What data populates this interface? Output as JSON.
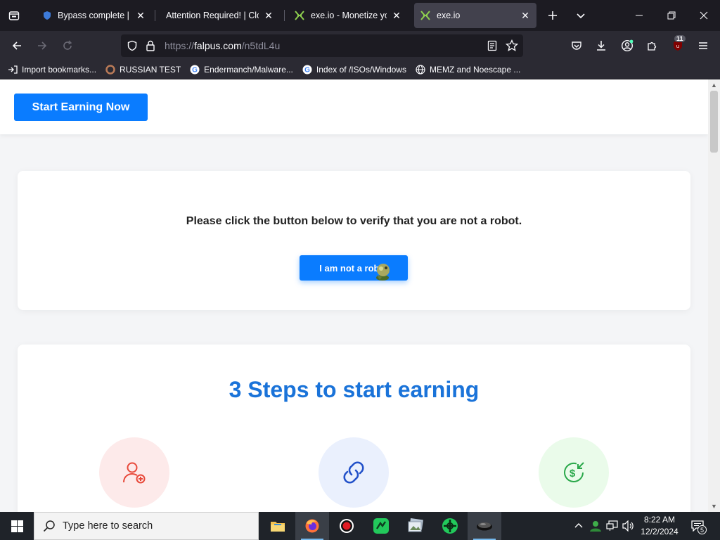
{
  "browser": {
    "tabs": [
      {
        "title": "Bypass complete | Byp",
        "active": false
      },
      {
        "title": "Attention Required! | Cloud",
        "active": false
      },
      {
        "title": "exe.io - Monetize your",
        "active": false
      },
      {
        "title": "exe.io",
        "active": true
      }
    ],
    "url": {
      "scheme": "https://",
      "host": "falpus.com",
      "path": "/n5tdL4u"
    },
    "extension_badge": "11",
    "bookmarks": [
      {
        "label": "Import bookmarks...",
        "icon": "import-icon"
      },
      {
        "label": "RUSSIAN TEST",
        "icon": "globe-icon"
      },
      {
        "label": "Endermanch/Malware...",
        "icon": "google-icon"
      },
      {
        "label": "Index of /ISOs/Windows",
        "icon": "google-icon"
      },
      {
        "label": "MEMZ and Noescape ...",
        "icon": "globe-icon"
      }
    ]
  },
  "page": {
    "header": {
      "start_button": "Start Earning Now"
    },
    "verify": {
      "message": "Please click the button below to verify that you are not a robot.",
      "button_label": "I am not a robot"
    },
    "steps": {
      "title": "3 Steps to start earning"
    }
  },
  "taskbar": {
    "search_placeholder": "Type here to search",
    "time": "8:22 AM",
    "date": "12/2/2024",
    "notification_count": "5"
  },
  "colors": {
    "accent": "#0a7cff",
    "steps_title": "#1a73d9",
    "step1_bg": "#fdeaea",
    "step2_bg": "#eaf0fd",
    "step3_bg": "#eafbea"
  }
}
